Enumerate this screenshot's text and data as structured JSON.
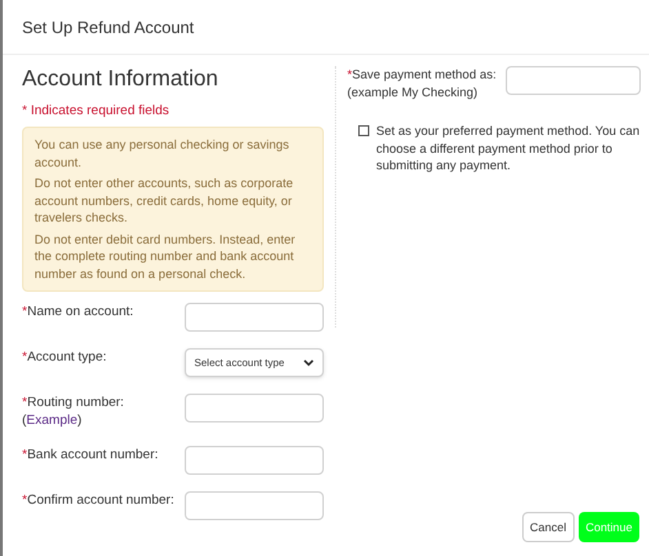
{
  "dialog": {
    "title": "Set Up Refund Account"
  },
  "section": {
    "heading": "Account Information",
    "required_note": "* Indicates required fields"
  },
  "notice": [
    "You can use any personal checking or savings account.",
    "Do not enter other accounts, such as corporate account numbers, credit cards, home equity, or travelers checks.",
    "Do not enter debit card numbers. Instead, enter the complete routing number and bank account number as found on a personal check."
  ],
  "fields": [
    {
      "kind": "text",
      "label": "*Name on account:"
    },
    {
      "kind": "select",
      "label": "*Account type:",
      "placeholder": "Select account type"
    },
    {
      "kind": "text",
      "label": "*Routing number:",
      "link_open": "(",
      "link": "Example",
      "link_close": ")"
    },
    {
      "kind": "text",
      "label": "*Bank account number:"
    },
    {
      "kind": "text",
      "label": "*Confirm account number:"
    }
  ],
  "save_as": {
    "label": "*Save payment method as:",
    "hint": "(example My Checking)"
  },
  "preferred": {
    "label": "Set as your preferred payment method. You can choose a different payment method prior to submitting any payment.",
    "checked": false
  },
  "buttons": [
    {
      "kind": "secondary",
      "label": "Cancel"
    },
    {
      "kind": "primary",
      "label": "Continue"
    }
  ]
}
